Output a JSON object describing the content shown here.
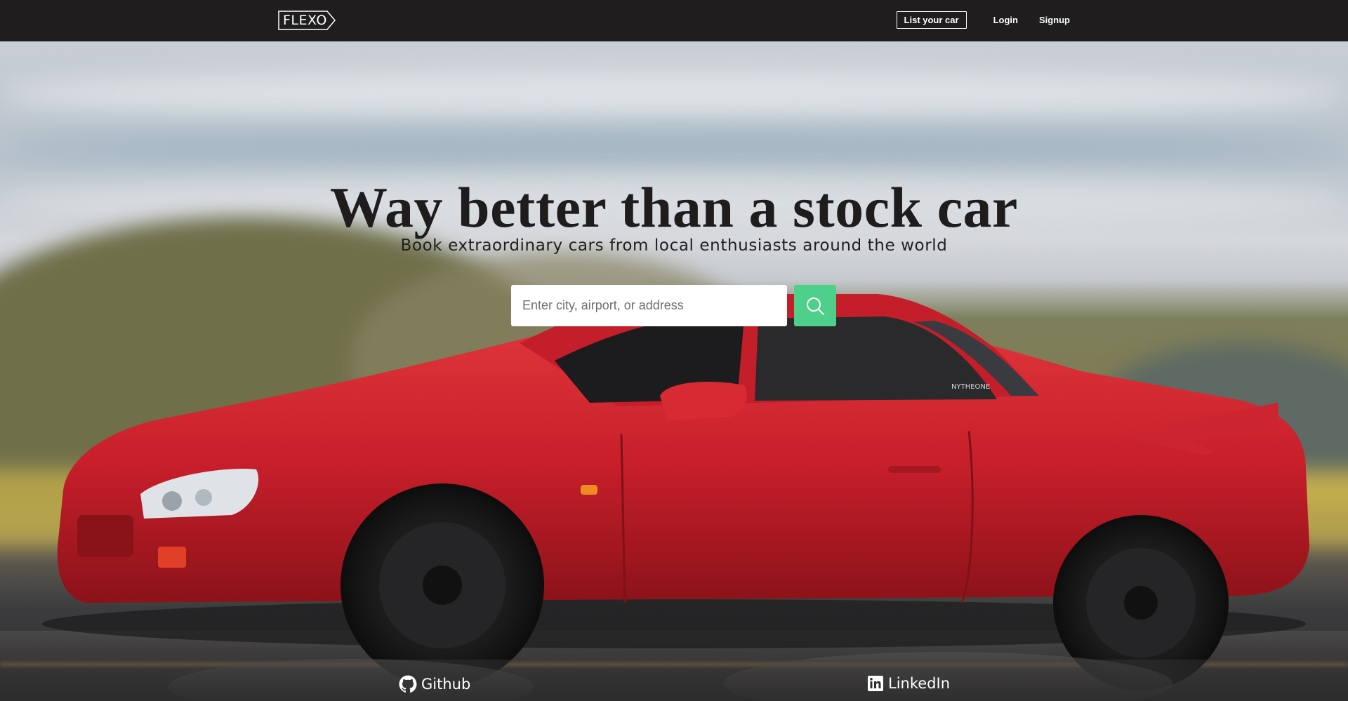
{
  "navbar": {
    "logo_text": "FLEXO",
    "links": {
      "list_car": "List your car",
      "login": "Login",
      "signup": "Signup"
    }
  },
  "hero": {
    "headline": "Way better than a stock car",
    "subheadline": "Book extraordinary cars from local enthusiasts around the world",
    "car_decal": "NYTHEONE"
  },
  "search": {
    "placeholder": "Enter city, airport, or address",
    "value": "",
    "button_icon": "search-icon"
  },
  "footer": {
    "github_label": "Github",
    "github_icon": "github-icon",
    "linkedin_label": "LinkedIn",
    "linkedin_icon": "linkedin-icon"
  },
  "colors": {
    "navbar_bg": "#1f1d1d",
    "accent_green": "#4fd08a",
    "car_red": "#d2232f",
    "text_dark": "#1e1c1d"
  }
}
